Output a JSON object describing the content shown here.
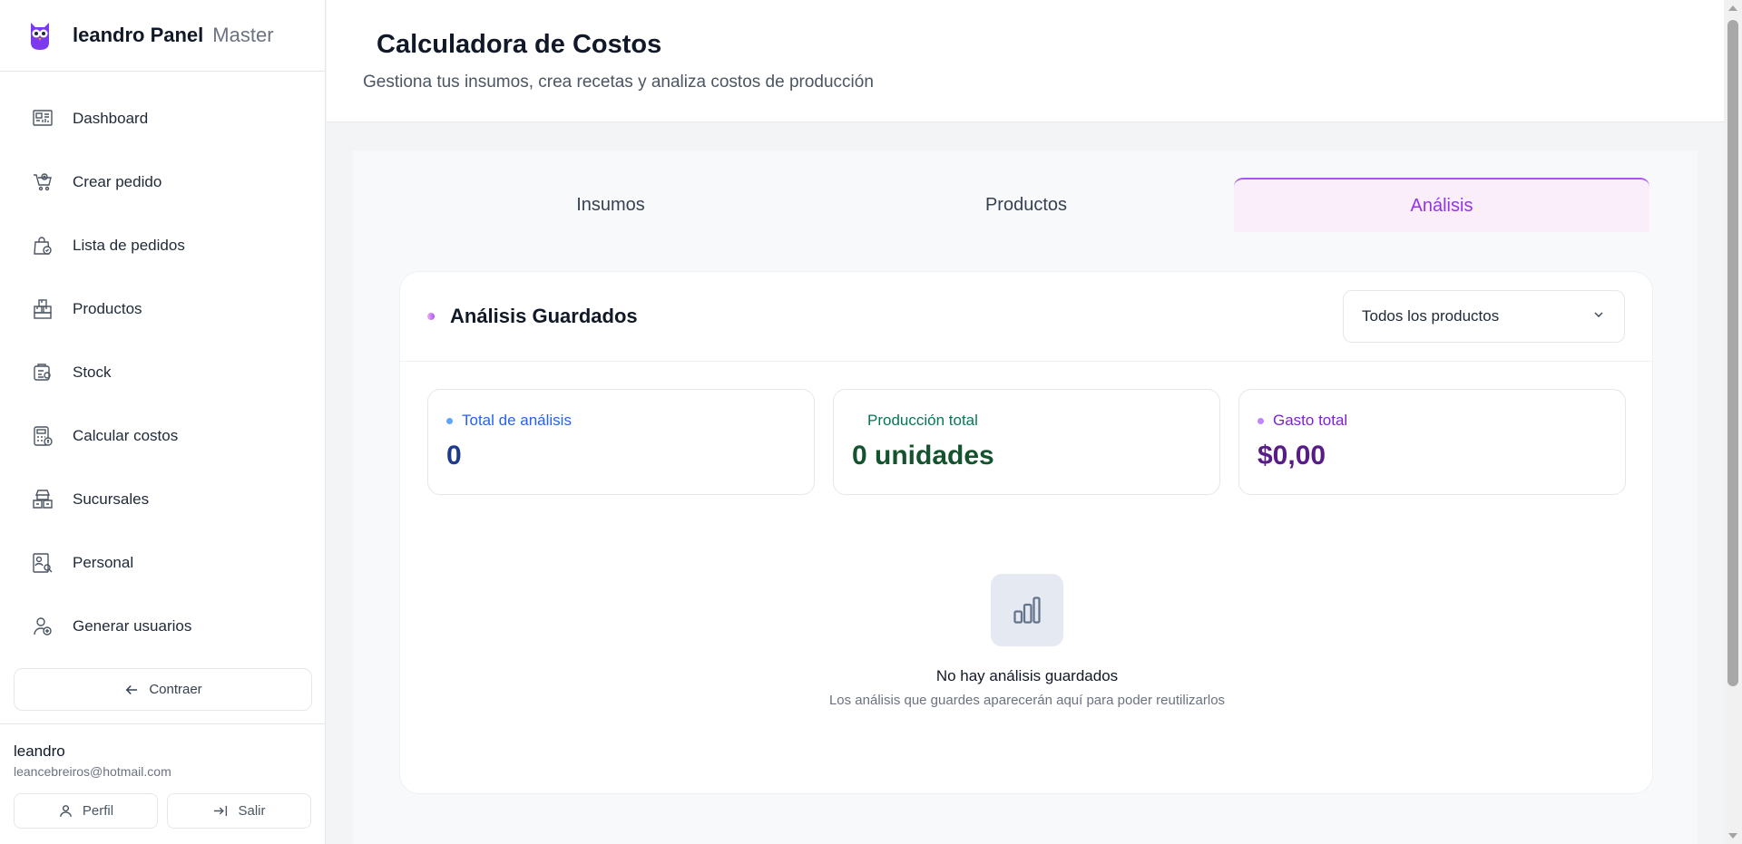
{
  "app": {
    "brand_name": "leandro Panel",
    "brand_role": "Master"
  },
  "sidebar": {
    "items": [
      {
        "label": "Dashboard",
        "icon": "dashboard-icon"
      },
      {
        "label": "Crear pedido",
        "icon": "cart-add-icon"
      },
      {
        "label": "Lista de pedidos",
        "icon": "bag-check-icon"
      },
      {
        "label": "Productos",
        "icon": "boxes-icon"
      },
      {
        "label": "Stock",
        "icon": "stock-icon"
      },
      {
        "label": "Calcular costos",
        "icon": "calculator-icon"
      },
      {
        "label": "Sucursales",
        "icon": "store-icon"
      },
      {
        "label": "Personal",
        "icon": "id-search-icon"
      },
      {
        "label": "Generar usuarios",
        "icon": "user-add-icon"
      }
    ],
    "collapse_label": "Contraer"
  },
  "user": {
    "name": "leandro",
    "email": "leancebreiros@hotmail.com",
    "profile_label": "Perfil",
    "logout_label": "Salir"
  },
  "header": {
    "title": "Calculadora de Costos",
    "subtitle": "Gestiona tus insumos, crea recetas y analiza costos de producción"
  },
  "tabs": [
    {
      "label": "Insumos",
      "active": false
    },
    {
      "label": "Productos",
      "active": false
    },
    {
      "label": "Análisis",
      "active": true
    }
  ],
  "analysis": {
    "title": "Análisis Guardados",
    "filter_selected": "Todos los productos",
    "stats": [
      {
        "label": "Total de análisis",
        "value": "0",
        "color": "#1e3a8a",
        "label_color": "#2563eb",
        "dot_color": "#60a5fa"
      },
      {
        "label": "Producción total",
        "value": "0 unidades",
        "color": "#14532d",
        "label_color": "#047857",
        "dot_color": "#ffffff"
      },
      {
        "label": "Gasto total",
        "value": "$0,00",
        "color": "#581c87",
        "label_color": "#7e22ce",
        "dot_color": "#c084fc"
      }
    ],
    "empty_title": "No hay análisis guardados",
    "empty_desc": "Los análisis que guardes aparecerán aquí para poder reutilizarlos"
  },
  "colors": {
    "accent": "#a855f7",
    "brand_logo": "#7c3aed"
  }
}
